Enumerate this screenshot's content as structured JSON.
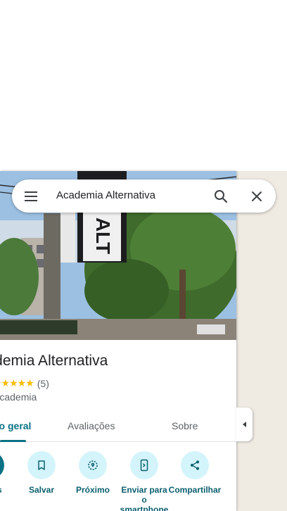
{
  "search": {
    "query": "Academia Alternativa"
  },
  "place": {
    "title": "Academia Alternativa",
    "stars_glyphs": "★★★★★",
    "rating": 5,
    "review_count": "(5)",
    "category": "Academia"
  },
  "tabs": [
    {
      "label": "Visão geral",
      "active": true
    },
    {
      "label": "Avaliações",
      "active": false
    },
    {
      "label": "Sobre",
      "active": false
    }
  ],
  "actions": [
    {
      "label": "Rotas",
      "icon": "directions-icon"
    },
    {
      "label": "Salvar",
      "icon": "bookmark-icon"
    },
    {
      "label": "Próximo",
      "icon": "nearby-icon"
    },
    {
      "label": "Enviar para o smartphone",
      "icon": "send-to-phone-icon"
    },
    {
      "label": "Compartilhar",
      "icon": "share-icon"
    }
  ],
  "colors": {
    "accent": "#0b7285",
    "action_bg": "#d3f4fa",
    "star": "#fbbc04",
    "map_bg": "#efebe3"
  }
}
